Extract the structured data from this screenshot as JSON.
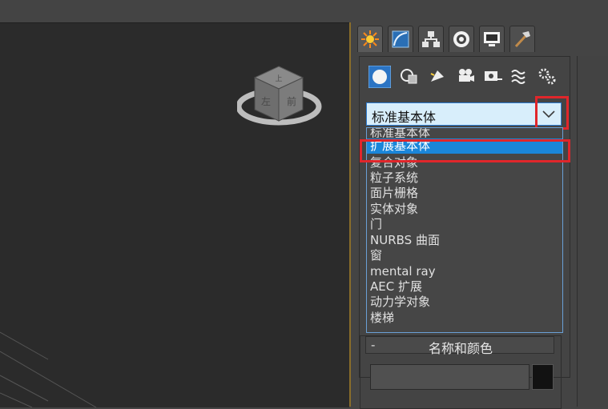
{
  "command_panel": {
    "tabs": [
      {
        "name": "create-tab",
        "icon": "create-sun-icon",
        "active": true
      },
      {
        "name": "modify-tab",
        "icon": "modify-curve-icon",
        "active": false
      },
      {
        "name": "hierarchy-tab",
        "icon": "hierarchy-icon",
        "active": false
      },
      {
        "name": "motion-tab",
        "icon": "motion-disc-icon",
        "active": false
      },
      {
        "name": "display-tab",
        "icon": "display-monitor-icon",
        "active": false
      },
      {
        "name": "utilities-tab",
        "icon": "utilities-hammer-icon",
        "active": false
      }
    ],
    "object_types": [
      {
        "name": "geometry",
        "icon": "sphere-icon",
        "active": true
      },
      {
        "name": "shapes",
        "icon": "shapes-icon",
        "active": false
      },
      {
        "name": "lights",
        "icon": "light-icon",
        "active": false
      },
      {
        "name": "cameras",
        "icon": "camera-icon",
        "active": false
      },
      {
        "name": "helpers",
        "icon": "tape-measure-icon",
        "active": false
      },
      {
        "name": "space-warps",
        "icon": "wave-icon",
        "active": false
      },
      {
        "name": "systems",
        "icon": "gears-icon",
        "active": false
      }
    ],
    "category_dropdown": {
      "selected": "标准基本体",
      "options": [
        "标准基本体",
        "扩展基本体",
        "复合对象",
        "粒子系统",
        "面片栅格",
        "实体对象",
        "门",
        "NURBS 曲面",
        "窗",
        "mental ray",
        "AEC 扩展",
        "动力学对象",
        "楼梯"
      ],
      "highlighted_index": 1
    },
    "name_and_color": {
      "collapse_symbol": "-",
      "title": "名称和颜色",
      "name_value": "",
      "color": "#121212"
    }
  },
  "viewcube": {
    "face_top": "上",
    "face_front": "左",
    "face_right": "前"
  },
  "colors": {
    "viewport_bg": "#2b2b2b",
    "panel_bg": "#444444",
    "highlight": "#1a86d9",
    "annotation_red": "#e0262b"
  }
}
